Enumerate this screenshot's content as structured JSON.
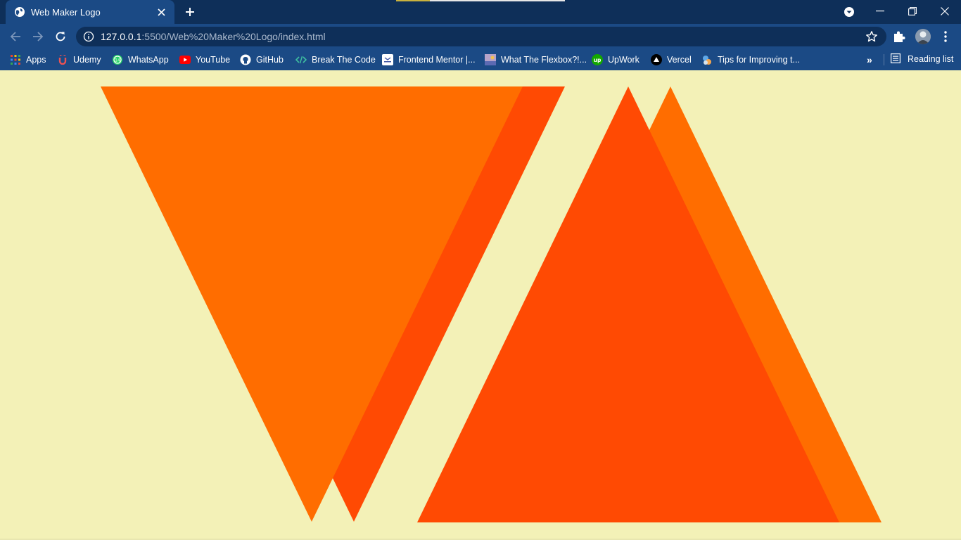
{
  "browser": {
    "tab_title": "Web Maker Logo",
    "url_host": "127.0.0.1",
    "url_path": ":5500/Web%20Maker%20Logo/index.html"
  },
  "bookmarks": [
    {
      "label": "Apps",
      "icon": "apps-grid-icon"
    },
    {
      "label": "Udemy",
      "icon": "udemy-icon"
    },
    {
      "label": "WhatsApp",
      "icon": "whatsapp-icon"
    },
    {
      "label": "YouTube",
      "icon": "youtube-icon"
    },
    {
      "label": "GitHub",
      "icon": "github-icon"
    },
    {
      "label": "Break The Code",
      "icon": "code-icon"
    },
    {
      "label": "Frontend Mentor |...",
      "icon": "frontend-mentor-icon"
    },
    {
      "label": "What The Flexbox?!...",
      "icon": "flexbox-icon"
    },
    {
      "label": "UpWork",
      "icon": "upwork-icon"
    },
    {
      "label": "Vercel",
      "icon": "vercel-icon"
    },
    {
      "label": "Tips for Improving t...",
      "icon": "tips-icon"
    }
  ],
  "reading_list_label": "Reading list",
  "logo": {
    "colors": {
      "orange": "#ff6d00",
      "red_orange": "#ff4a03",
      "background": "#f3f1b7"
    },
    "shapes": [
      "inverted-triangle-back",
      "inverted-triangle-front",
      "upright-triangle-back",
      "upright-triangle-front"
    ]
  }
}
